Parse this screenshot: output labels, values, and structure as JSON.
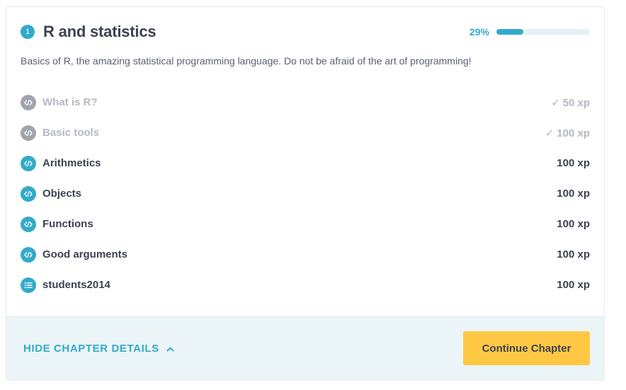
{
  "chapter": {
    "number": "1",
    "title": "R and statistics",
    "progress_label": "29%",
    "progress_fraction": 0.29,
    "description": "Basics of R, the amazing statistical programming language. Do not be afraid of the art of programming!"
  },
  "exercises": [
    {
      "title": "What is R?",
      "xp": "50 xp",
      "done": true,
      "icon": "code-icon"
    },
    {
      "title": "Basic tools",
      "xp": "100 xp",
      "done": true,
      "icon": "code-icon"
    },
    {
      "title": "Arithmetics",
      "xp": "100 xp",
      "done": false,
      "icon": "code-icon"
    },
    {
      "title": "Objects",
      "xp": "100 xp",
      "done": false,
      "icon": "code-icon"
    },
    {
      "title": "Functions",
      "xp": "100 xp",
      "done": false,
      "icon": "code-icon"
    },
    {
      "title": "Good arguments",
      "xp": "100 xp",
      "done": false,
      "icon": "code-icon"
    },
    {
      "title": "students2014",
      "xp": "100 xp",
      "done": false,
      "icon": "list-icon"
    }
  ],
  "footer": {
    "hide_details_label": "HIDE CHAPTER DETAILS",
    "continue_label": "Continue Chapter"
  },
  "colors": {
    "accent": "#33aacc",
    "completed_gray": "#a0a4ad",
    "button_yellow": "#ffc844",
    "footer_bg": "#ebf4f7"
  }
}
